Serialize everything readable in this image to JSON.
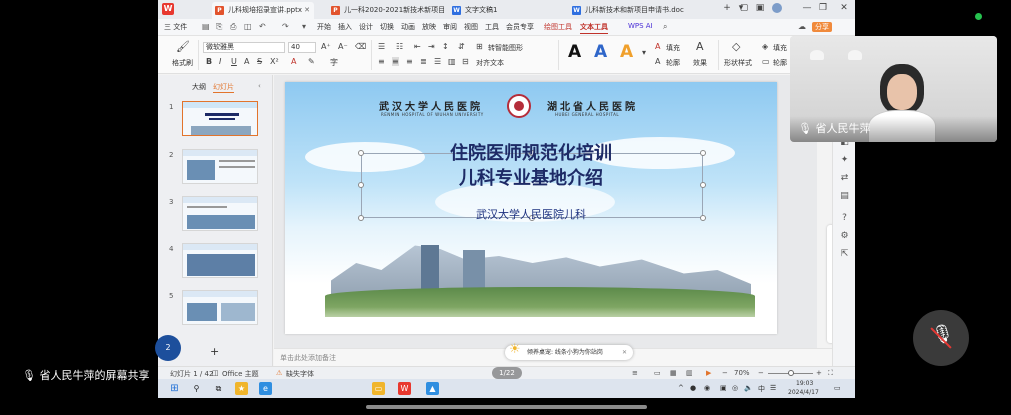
{
  "tabs": [
    {
      "label": "儿科规培招录宣讲.pptx",
      "type": "P",
      "color": "#e2532d",
      "active": true
    },
    {
      "label": "儿一科2020-2021新技术新项目",
      "type": "P",
      "color": "#e2532d"
    },
    {
      "label": "文字文稿1",
      "type": "W",
      "color": "#2f6fe0"
    },
    {
      "label": "儿科新技术和新项目申请书.doc",
      "type": "W",
      "color": "#2f6fe0"
    }
  ],
  "menu": {
    "file": "三 文件",
    "items": [
      "开始",
      "插入",
      "设计",
      "切换",
      "动画",
      "放映",
      "审阅",
      "视图",
      "工具",
      "会员专享"
    ],
    "drawing_tools": "绘图工具",
    "text_tools": "文本工具",
    "wps_ai": "WPS AI",
    "share": "分享"
  },
  "ribbon": {
    "format_painter": "格式刷",
    "font_name": "微软雅黑",
    "font_size": "40",
    "convert_smartart": "转智能图形",
    "text_align": "对齐文本",
    "fill": "填充",
    "outline": "轮廓",
    "effect": "效果",
    "shape_style": "形状样式",
    "fill2": "填充",
    "outline2": "轮廓"
  },
  "left_panel": {
    "outline_tab": "大纲",
    "slides_tab": "幻灯片",
    "slide_numbers": [
      "1",
      "2",
      "3",
      "4",
      "5"
    ],
    "add_symbol": "+"
  },
  "slide": {
    "logo_left_cn": "武汉大学人民医院",
    "logo_left_en": "RENMIN HOSPITAL OF WUHAN UNIVERSITY",
    "logo_right_cn": "湖北省人民医院",
    "logo_right_en": "HUBEI GENERAL HOSPITAL",
    "title_line1": "住院医师规范化培训",
    "title_line2": "儿科专业基地介绍",
    "subtitle": "武汉大学人民医院儿科"
  },
  "notes_placeholder": "单击此处添加备注",
  "status": {
    "page": "幻灯片 1 / 42",
    "theme": "Office 主题",
    "missing_font": "缺失字体",
    "zoom": "70%"
  },
  "pager": "1/22",
  "tooltip": "倾养桌宠: 线条小狗为你站岗",
  "taskbar": {
    "time": "19:03",
    "date": "2024/4/17",
    "lang": "中"
  },
  "video_name": "省人民牛萍",
  "share_label": "省人民牛萍的屏幕共享",
  "avatar_text": "2"
}
